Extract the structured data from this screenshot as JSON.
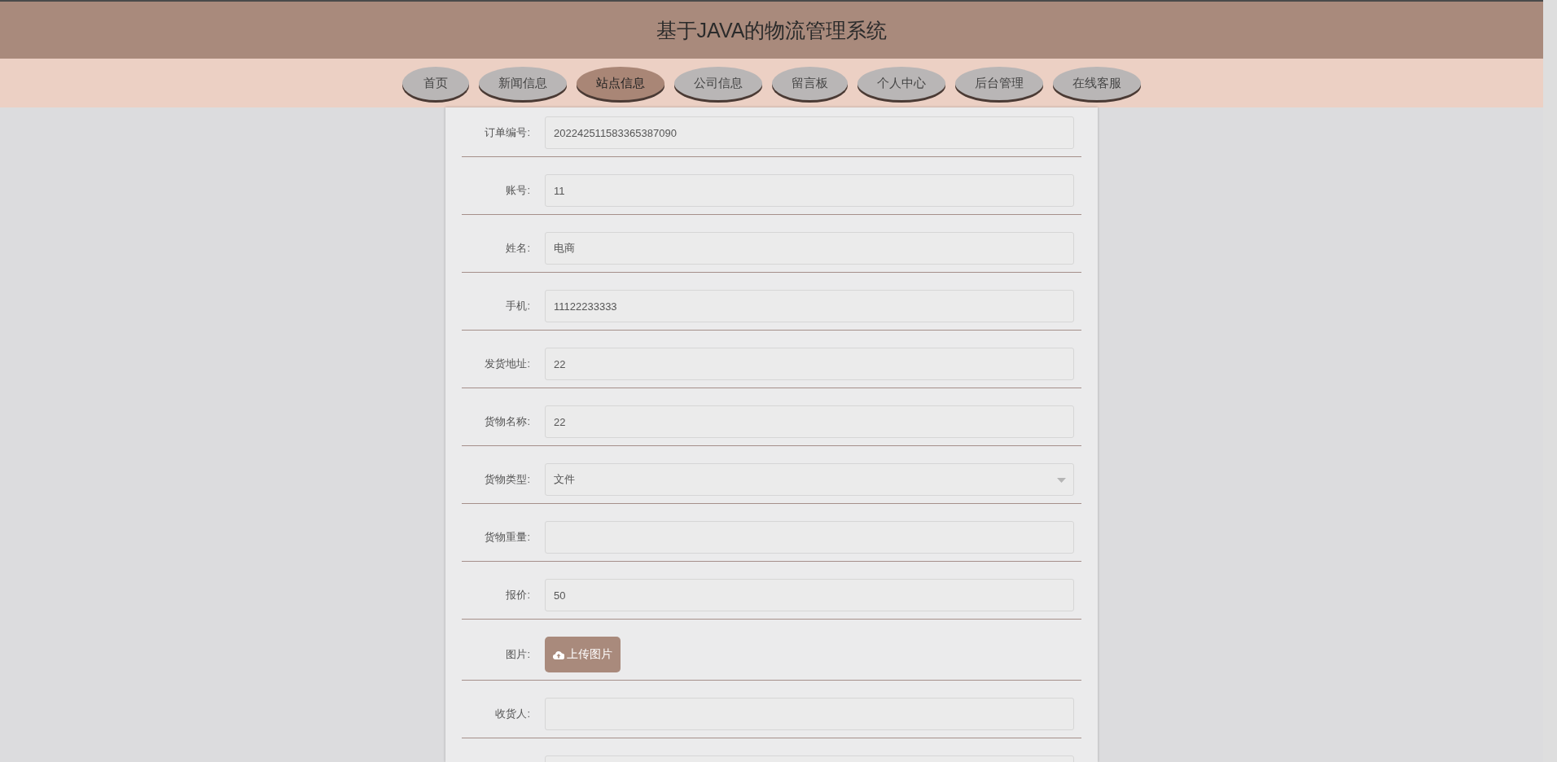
{
  "header": {
    "title": "基于JAVA的物流管理系统"
  },
  "nav": [
    {
      "label": "首页",
      "selected": false
    },
    {
      "label": "新闻信息",
      "selected": false
    },
    {
      "label": "站点信息",
      "selected": true
    },
    {
      "label": "公司信息",
      "selected": false
    },
    {
      "label": "留言板",
      "selected": false
    },
    {
      "label": "个人中心",
      "selected": false
    },
    {
      "label": "后台管理",
      "selected": false
    },
    {
      "label": "在线客服",
      "selected": false
    }
  ],
  "form": {
    "fields": [
      {
        "kind": "text",
        "label": "订单编号:",
        "value": "202242511583365387090"
      },
      {
        "kind": "text",
        "label": "账号:",
        "value": "11"
      },
      {
        "kind": "text",
        "label": "姓名:",
        "value": "电商"
      },
      {
        "kind": "text",
        "label": "手机:",
        "value": "11122233333"
      },
      {
        "kind": "text",
        "label": "发货地址:",
        "value": "22"
      },
      {
        "kind": "text",
        "label": "货物名称:",
        "value": "22"
      },
      {
        "kind": "select",
        "label": "货物类型:",
        "value": "文件"
      },
      {
        "kind": "text",
        "label": "货物重量:"
      },
      {
        "kind": "text",
        "label": "报价:",
        "value": "50"
      },
      {
        "kind": "upload",
        "label": "图片:",
        "button": "上传图片"
      },
      {
        "kind": "text",
        "label": "收货人:"
      },
      {
        "kind": "text"
      }
    ]
  }
}
